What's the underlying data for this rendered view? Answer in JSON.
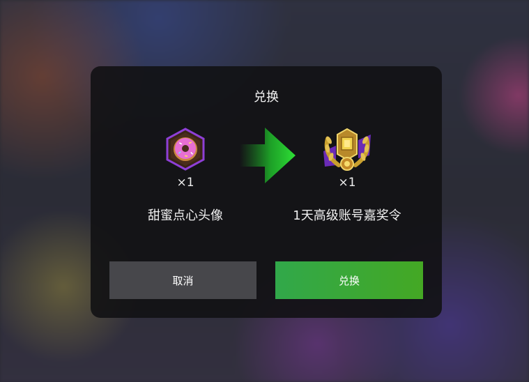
{
  "dialog": {
    "title": "兑换",
    "source_item": {
      "count": "×1",
      "name": "甜蜜点心头像",
      "icon": "donut-avatar-icon"
    },
    "target_item": {
      "count": "×1",
      "name": "1天高级账号嘉奖令",
      "icon": "premium-laurel-badge-icon"
    },
    "cancel_label": "取消",
    "confirm_label": "兑换"
  },
  "colors": {
    "dialog_bg": "#121214",
    "cancel_button": "#47474b",
    "confirm_button": "#3aa838",
    "arrow_green": "#27d62a",
    "hex_border": "#8e3fd6",
    "donut_pink": "#e76fd3"
  }
}
